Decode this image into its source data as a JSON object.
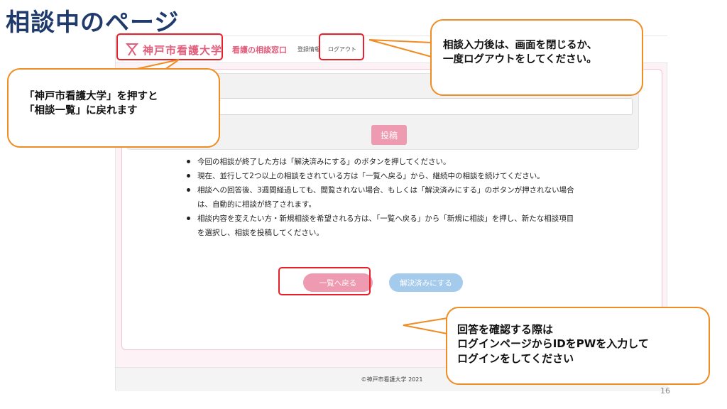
{
  "slide": {
    "title": "相談中のページ",
    "page_number": "16"
  },
  "header": {
    "logo_text": "神戸市看護大学",
    "nav_title": "看護の相談窓口",
    "nav_registration": "登録情報",
    "nav_logout": "ログアウト"
  },
  "form": {
    "post_button": "投稿"
  },
  "notes": [
    "今回の相談が終了した方は「解決済みにする」のボタンを押してください。",
    "現在、並行して2つ以上の相談をされている方は「一覧へ戻る」から、継続中の相談を続けてください。",
    "相談への回答後、3週間経過しても、閲覧されない場合、もしくは「解決済みにする」のボタンが押されない場合は、自動的に相談が終了されます。",
    "相談内容を変えたい方・新規相談を希望される方は、「一覧へ戻る」から「新規に相談」を押し、新たな相談項目を選択し、相談を投稿してください。"
  ],
  "buttons": {
    "back_to_list": "一覧へ戻る",
    "mark_resolved": "解決済みにする"
  },
  "footer": {
    "copyright": "©神戸市看護大学 2021"
  },
  "callouts": {
    "logout_line1": "相談入力後は、画面を閉じるか、",
    "logout_line2": "一度ログアウトをしてください。",
    "logo_line1": "「神戸市看護大学」を押すと",
    "logo_line2": "「相談一覧」に戻れます",
    "login_line1": "回答を確認する際は",
    "login_line2": "ログインページからIDをPWを入力して",
    "login_line3": "ログインをしてください"
  },
  "colors": {
    "accent_pink": "#e05d7c",
    "button_pink": "#ee9ab0",
    "button_blue": "#a5cbec",
    "highlight_red": "#e8202a",
    "callout_orange": "#f08c24",
    "title_navy": "#1f3a6b"
  }
}
